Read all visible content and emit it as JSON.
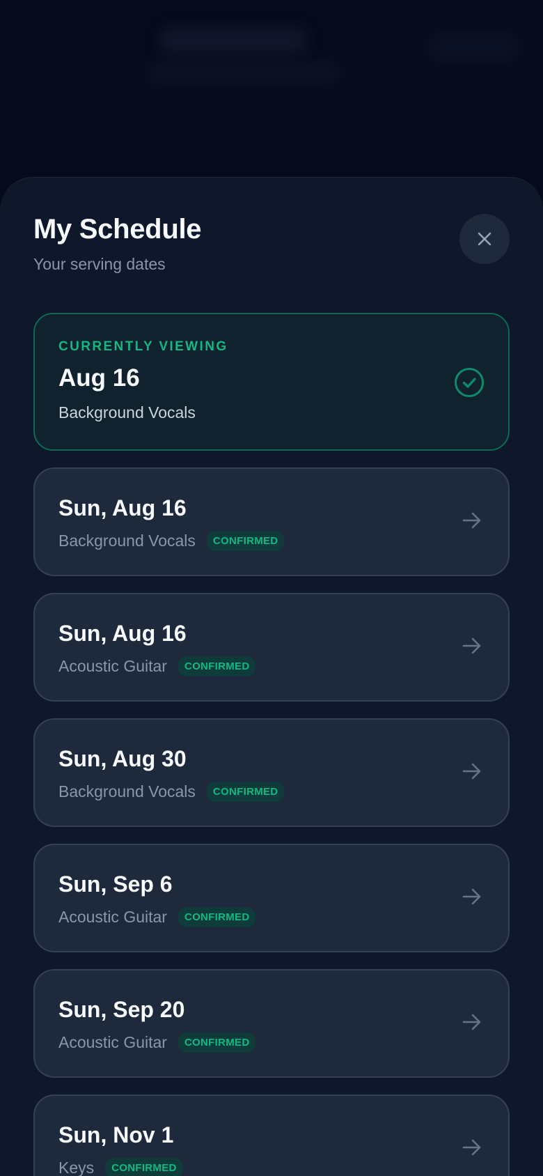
{
  "sheet": {
    "title": "My Schedule",
    "subtitle": "Your serving dates",
    "close_icon": "close-icon"
  },
  "current": {
    "kicker": "CURRENTLY VIEWING",
    "date": "Aug 16",
    "role": "Background Vocals",
    "icon": "check-circle-icon"
  },
  "schedule": [
    {
      "date": "Sun, Aug 16",
      "role": "Background Vocals",
      "status": "CONFIRMED"
    },
    {
      "date": "Sun, Aug 16",
      "role": "Acoustic Guitar",
      "status": "CONFIRMED"
    },
    {
      "date": "Sun, Aug 30",
      "role": "Background Vocals",
      "status": "CONFIRMED"
    },
    {
      "date": "Sun, Sep 6",
      "role": "Acoustic Guitar",
      "status": "CONFIRMED"
    },
    {
      "date": "Sun, Sep 20",
      "role": "Acoustic Guitar",
      "status": "CONFIRMED"
    },
    {
      "date": "Sun, Nov 1",
      "role": "Keys",
      "status": "CONFIRMED"
    }
  ],
  "colors": {
    "accent": "#10b981",
    "sheet_bg": "#0f172a",
    "card_bg": "#1e293b",
    "current_border": "#0e6a57"
  }
}
